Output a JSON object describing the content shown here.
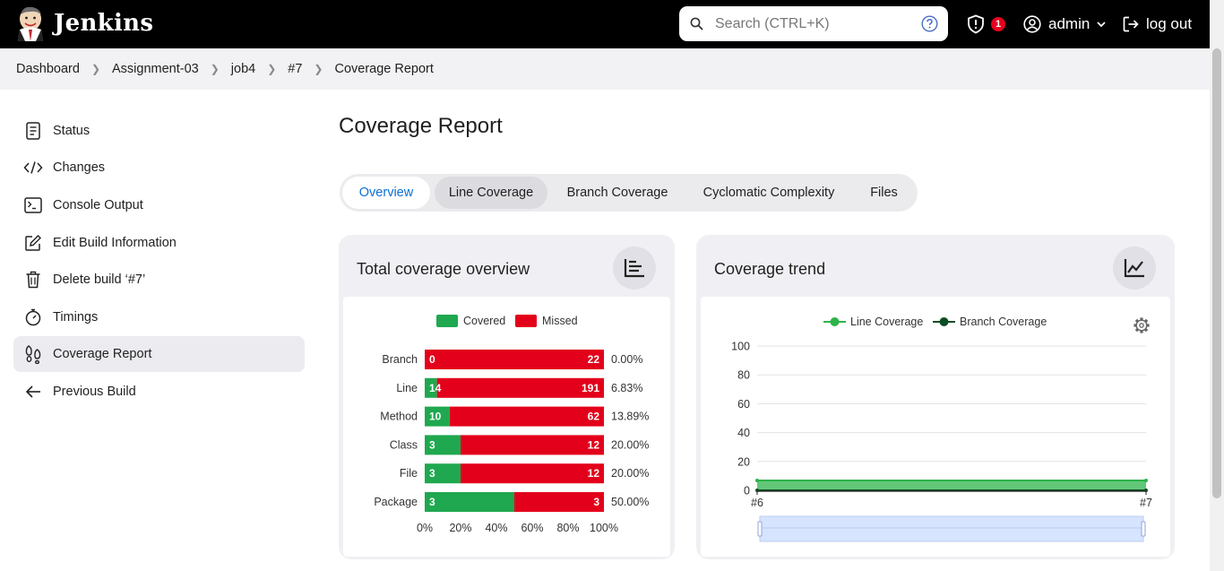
{
  "header": {
    "brand": "Jenkins",
    "search_placeholder": "Search (CTRL+K)",
    "alerts_count": "1",
    "user": "admin",
    "logout": "log out"
  },
  "breadcrumb": [
    "Dashboard",
    "Assignment-03",
    "job4",
    "#7",
    "Coverage Report"
  ],
  "sidebar": {
    "items": [
      {
        "label": "Status",
        "icon": "status-icon"
      },
      {
        "label": "Changes",
        "icon": "code-icon"
      },
      {
        "label": "Console Output",
        "icon": "terminal-icon"
      },
      {
        "label": "Edit Build Information",
        "icon": "edit-icon"
      },
      {
        "label": "Delete build ‘#7’",
        "icon": "trash-icon"
      },
      {
        "label": "Timings",
        "icon": "stopwatch-icon"
      },
      {
        "label": "Coverage Report",
        "icon": "footsteps-icon"
      },
      {
        "label": "Previous Build",
        "icon": "arrow-left-icon"
      }
    ],
    "active_index": 6
  },
  "page": {
    "title": "Coverage Report",
    "tabs": [
      "Overview",
      "Line Coverage",
      "Branch Coverage",
      "Cyclomatic Complexity",
      "Files"
    ],
    "active_tab": "Overview"
  },
  "overview_card": {
    "title": "Total coverage overview"
  },
  "trend_card": {
    "title": "Coverage trend"
  },
  "colors": {
    "covered": "#1fa84f",
    "missed": "#e3001b",
    "accent": "#0b6fd4",
    "line_trend": "#2db34a",
    "branch_trend": "#0d4d24"
  },
  "chart_data": [
    {
      "type": "bar",
      "stacked": true,
      "orientation": "horizontal",
      "legend": [
        "Covered",
        "Missed"
      ],
      "legend_position": "top",
      "categories": [
        "Branch",
        "Line",
        "Method",
        "Class",
        "File",
        "Package"
      ],
      "series": [
        {
          "name": "Covered",
          "values": [
            0,
            14,
            10,
            3,
            3,
            3
          ]
        },
        {
          "name": "Missed",
          "values": [
            22,
            191,
            62,
            12,
            12,
            3
          ]
        }
      ],
      "percent_labels": [
        "0.00%",
        "6.83%",
        "13.89%",
        "20.00%",
        "20.00%",
        "50.00%"
      ],
      "xticks": [
        "0%",
        "20%",
        "40%",
        "60%",
        "80%",
        "100%"
      ],
      "xlim": [
        0,
        100
      ]
    },
    {
      "type": "line",
      "legend": [
        "Line Coverage",
        "Branch Coverage"
      ],
      "legend_position": "top",
      "x": [
        "#6",
        "#7"
      ],
      "series": [
        {
          "name": "Line Coverage",
          "values": [
            6.83,
            6.83
          ]
        },
        {
          "name": "Branch Coverage",
          "values": [
            0,
            0
          ]
        }
      ],
      "yticks": [
        "0",
        "20",
        "40",
        "60",
        "80",
        "100"
      ],
      "ylim": [
        0,
        100
      ],
      "grid": true,
      "data_zoom": true
    }
  ]
}
